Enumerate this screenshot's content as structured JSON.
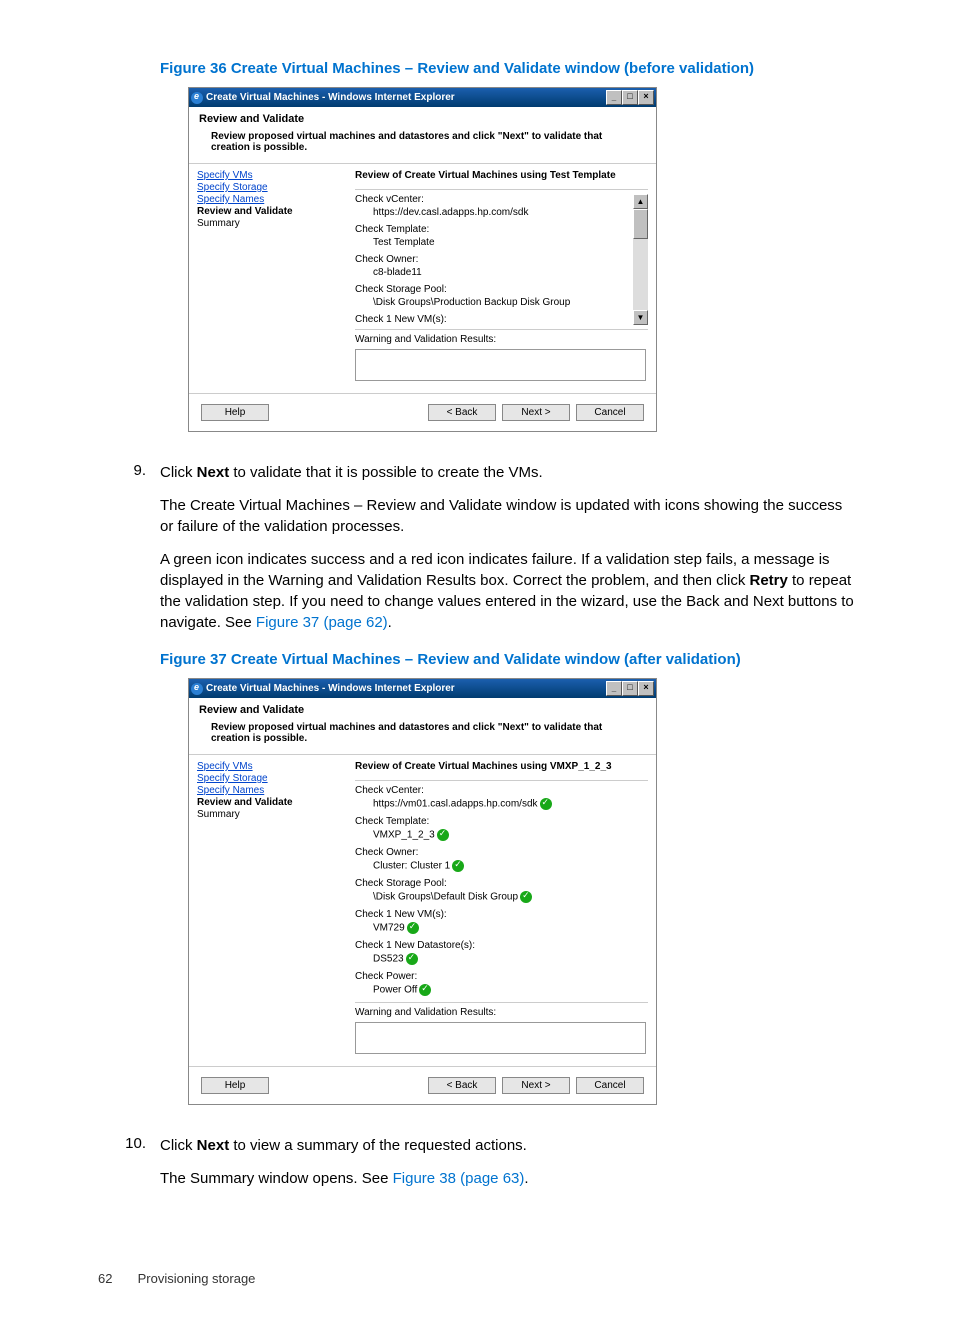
{
  "fig1": {
    "title": "Figure 36 Create Virtual Machines – Review and Validate window (before validation)"
  },
  "fig2": {
    "title": "Figure 37 Create Virtual Machines – Review and Validate window (after validation)"
  },
  "dlg1": {
    "winTitle": "Create Virtual Machines - Windows Internet Explorer",
    "heading": "Review and Validate",
    "desc": "Review proposed virtual machines and datastores and click \"Next\" to validate that creation is possible.",
    "nav": [
      "Specify VMs",
      "Specify Storage",
      "Specify Names",
      "Review and Validate",
      "Summary"
    ],
    "navCurrent": 3,
    "reviewTitle": "Review of Create Virtual Machines using Test Template",
    "checks": [
      {
        "label": "Check vCenter:",
        "value": "https://dev.casl.adapps.hp.com/sdk"
      },
      {
        "label": "Check Template:",
        "value": "Test Template"
      },
      {
        "label": "Check Owner:",
        "value": "c8-blade11"
      },
      {
        "label": "Check Storage Pool:",
        "value": "\\Disk Groups\\Production Backup Disk Group"
      },
      {
        "label": "Check 1 New VM(s):",
        "value": ""
      }
    ],
    "warnTitle": "Warning and Validation Results:",
    "help": "Help",
    "back": "< Back",
    "next": "Next >",
    "cancel": "Cancel"
  },
  "dlg2": {
    "winTitle": "Create Virtual Machines - Windows Internet Explorer",
    "heading": "Review and Validate",
    "desc": "Review proposed virtual machines and datastores and click \"Next\" to validate that creation is possible.",
    "nav": [
      "Specify VMs",
      "Specify Storage",
      "Specify Names",
      "Review and Validate",
      "Summary"
    ],
    "navCurrent": 3,
    "reviewTitle": "Review of Create Virtual Machines using VMXP_1_2_3",
    "checks": [
      {
        "label": "Check vCenter:",
        "value": "https://vm01.casl.adapps.hp.com/sdk",
        "ok": true
      },
      {
        "label": "Check Template:",
        "value": "VMXP_1_2_3",
        "ok": true
      },
      {
        "label": "Check Owner:",
        "value": "Cluster: Cluster 1",
        "ok": true
      },
      {
        "label": "Check Storage Pool:",
        "value": "\\Disk Groups\\Default Disk Group",
        "ok": true
      },
      {
        "label": "Check 1 New VM(s):",
        "value": "VM729",
        "ok": true
      },
      {
        "label": "Check 1 New Datastore(s):",
        "value": "DS523",
        "ok": true
      },
      {
        "label": "Check Power:",
        "value": "Power Off",
        "ok": true
      }
    ],
    "warnTitle": "Warning and Validation Results:",
    "help": "Help",
    "back": "< Back",
    "next": "Next >",
    "cancel": "Cancel"
  },
  "step9": {
    "num": "9.",
    "p1a": "Click ",
    "p1b": "Next",
    "p1c": " to validate that it is possible to create the VMs.",
    "p2": "The Create Virtual Machines – Review and Validate window is updated with icons showing the success or failure of the validation processes.",
    "p3a": "A green icon indicates success and a red icon indicates failure. If a validation step fails, a message is displayed in the Warning and Validation Results box. Correct the problem, and then click ",
    "p3b": "Retry",
    "p3c": " to repeat the validation step. If you need to change values entered in the wizard, use the Back and Next buttons to navigate. See ",
    "p3d": "Figure 37 (page 62)",
    "p3e": "."
  },
  "step10": {
    "num": "10.",
    "p1a": "Click ",
    "p1b": "Next",
    "p1c": " to view a summary of the requested actions.",
    "p2a": "The Summary window opens. See ",
    "p2b": "Figure 38 (page 63)",
    "p2c": "."
  },
  "footer": {
    "num": "62",
    "text": "Provisioning storage"
  }
}
